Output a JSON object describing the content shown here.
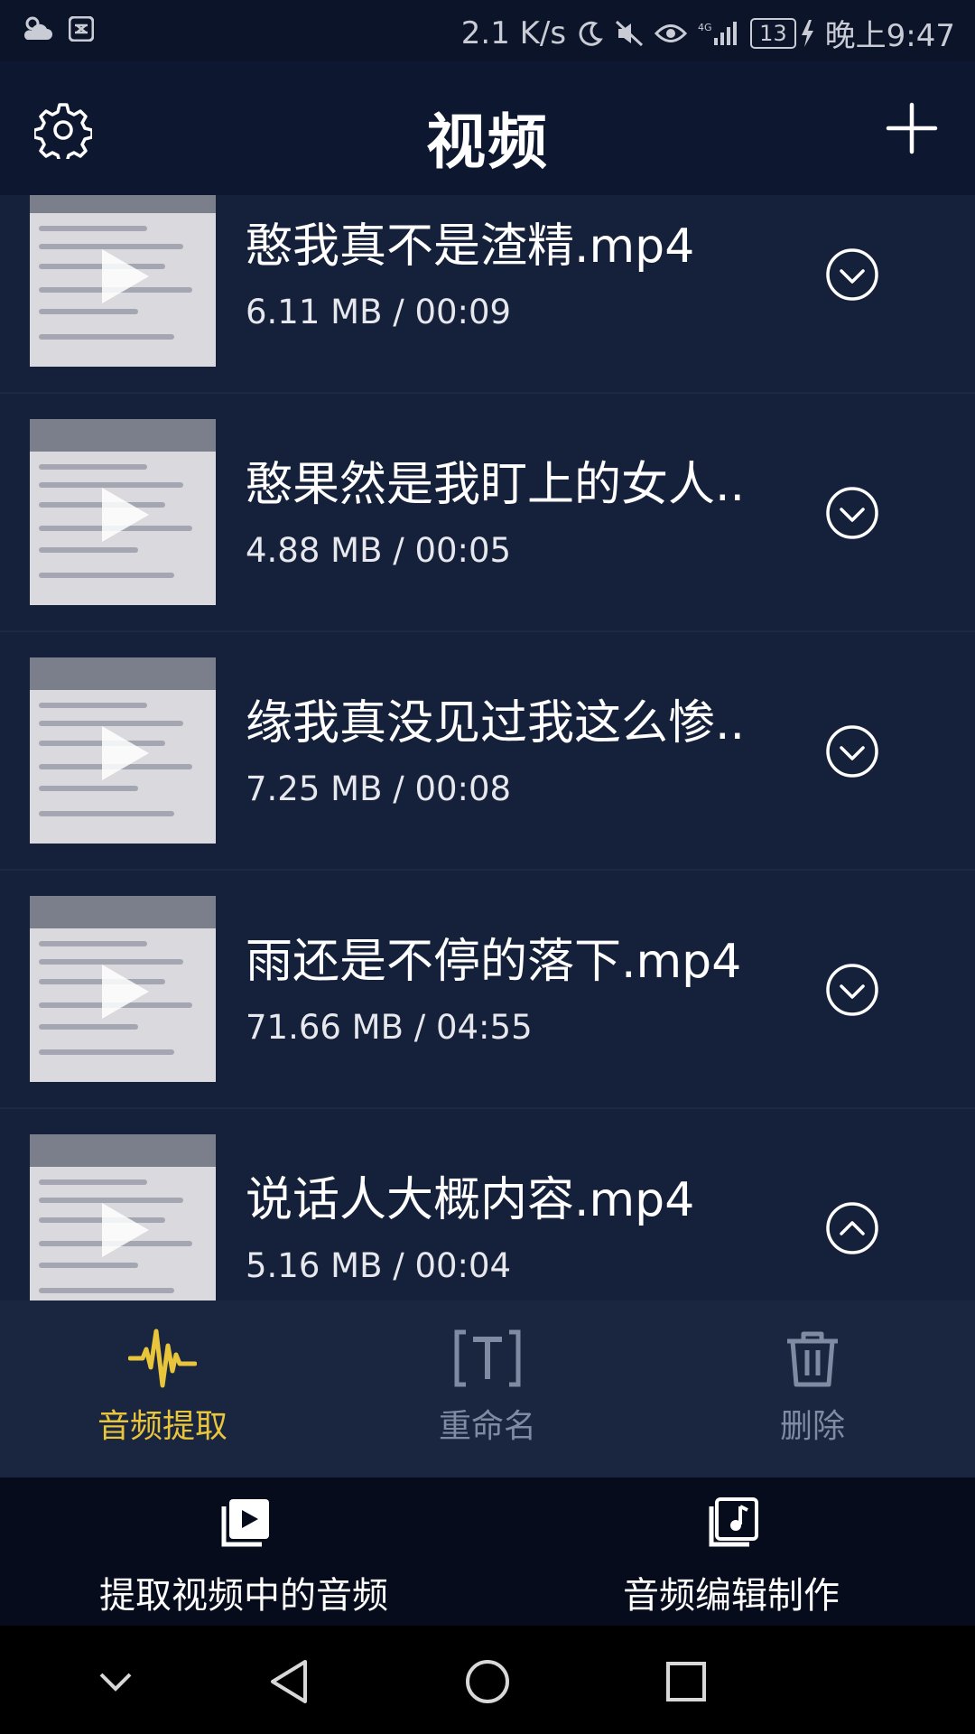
{
  "status_bar": {
    "speed": "2.1 K/s",
    "battery": "13",
    "time": "晚上9:47"
  },
  "header": {
    "title": "视频"
  },
  "videos": [
    {
      "name": "憨我真不是渣精.mp4",
      "meta": "6.11 MB / 00:09",
      "expanded": false
    },
    {
      "name": "憨果然是我盯上的女人..",
      "meta": "4.88 MB / 00:05",
      "expanded": false
    },
    {
      "name": "缘我真没见过我这么惨..",
      "meta": "7.25 MB / 00:08",
      "expanded": false
    },
    {
      "name": "雨还是不停的落下.mp4",
      "meta": "71.66 MB / 04:55",
      "expanded": false
    },
    {
      "name": "说话人大概内容.mp4",
      "meta": "5.16 MB / 00:04",
      "expanded": true
    }
  ],
  "actions": {
    "extract_audio": "音频提取",
    "rename": "重命名",
    "delete": "删除",
    "colors": {
      "active": "#e8c53a",
      "inactive": "#7f8aa3"
    }
  },
  "tabs": {
    "extract_from_video": "提取视频中的音频",
    "audio_edit": "音频编辑制作"
  }
}
